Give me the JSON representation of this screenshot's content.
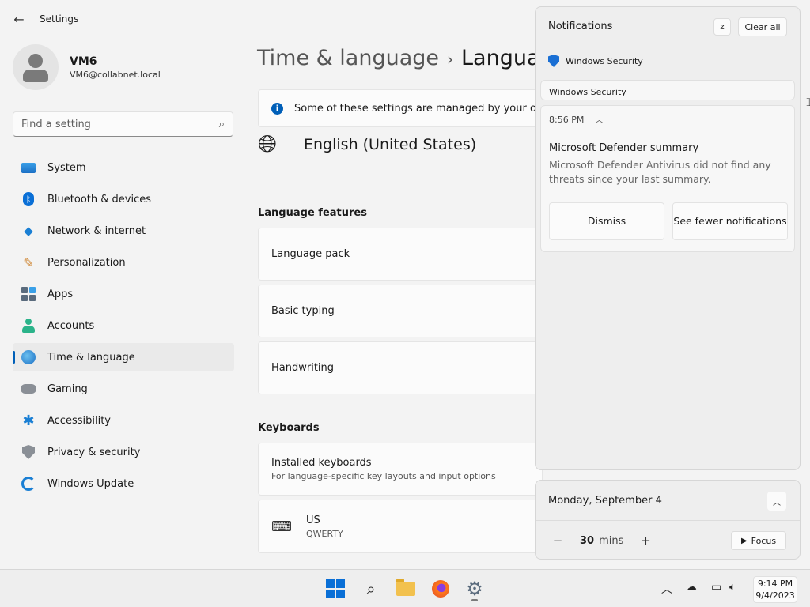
{
  "window": {
    "title": "Settings"
  },
  "profile": {
    "name": "VM6",
    "email": "VM6@collabnet.local"
  },
  "search": {
    "placeholder": "Find a setting"
  },
  "sidebar": {
    "items": [
      {
        "label": "System",
        "icon": "system-icon"
      },
      {
        "label": "Bluetooth & devices",
        "icon": "bluetooth-icon"
      },
      {
        "label": "Network & internet",
        "icon": "wifi-icon"
      },
      {
        "label": "Personalization",
        "icon": "brush-icon"
      },
      {
        "label": "Apps",
        "icon": "apps-icon"
      },
      {
        "label": "Accounts",
        "icon": "accounts-icon"
      },
      {
        "label": "Time & language",
        "icon": "globe-clock-icon",
        "active": true
      },
      {
        "label": "Gaming",
        "icon": "gamepad-icon"
      },
      {
        "label": "Accessibility",
        "icon": "accessibility-icon"
      },
      {
        "label": "Privacy & security",
        "icon": "shield-icon"
      },
      {
        "label": "Windows Update",
        "icon": "update-icon"
      }
    ]
  },
  "main": {
    "breadcrumb": {
      "parent": "Time & language",
      "current": "Languag"
    },
    "info_text": "Some of these settings are managed by your orga",
    "language": "English (United States)",
    "features_title": "Language features",
    "features": [
      "Language pack",
      "Basic typing",
      "Handwriting"
    ],
    "keyboards_title": "Keyboards",
    "installed_keyboards": {
      "label": "Installed keyboards",
      "sub": "For language-specific key layouts and input options"
    },
    "keyboard": {
      "name": "US",
      "layout": "QWERTY"
    }
  },
  "notifications": {
    "title": "Notifications",
    "clear_all": "Clear all",
    "app_name": "Windows Security",
    "stacked_label": "Windows Security",
    "toast": {
      "time": "8:56 PM",
      "title": "Microsoft Defender summary",
      "body": "Microsoft Defender Antivirus did not find any threats since your last summary.",
      "dismiss": "Dismiss",
      "fewer": "See fewer notifications"
    }
  },
  "calendar": {
    "date": "Monday, September 4",
    "focus_minutes": "30",
    "focus_unit": "mins",
    "focus_label": "Focus"
  },
  "taskbar": {
    "time": "9:14 PM",
    "date": "9/4/2023"
  },
  "colors": {
    "accent": "#005fb8",
    "background": "#f3f3f3"
  }
}
